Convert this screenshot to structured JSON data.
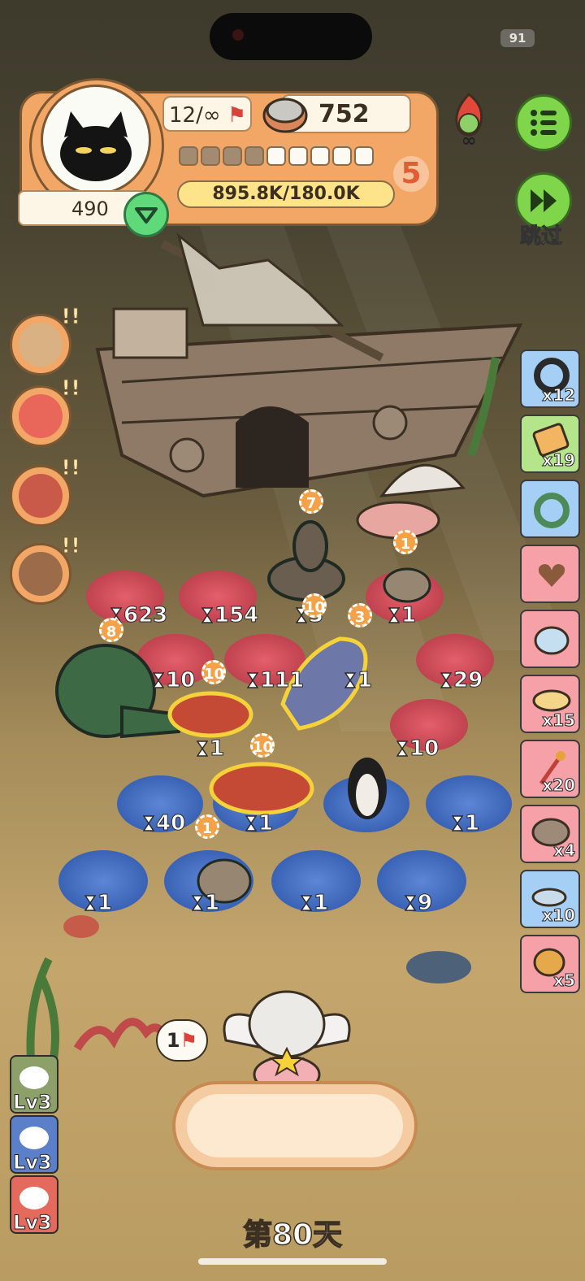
{
  "status_bar": {
    "battery": "91"
  },
  "profile": {
    "level_text": "12/∞",
    "coins": "752",
    "stage": "5",
    "progress_text": "895.8K/180.0K",
    "gems": "490",
    "segments_filled": 4,
    "segments_total": 9
  },
  "skip": {
    "label": "跳过"
  },
  "left_buttons": [
    "box-icon",
    "bear-icon",
    "phone-icon",
    "chest-icon"
  ],
  "items": [
    {
      "icon": "ring-icon",
      "count": "x12",
      "color": "blue"
    },
    {
      "icon": "ticket-icon",
      "count": "x19",
      "color": "green"
    },
    {
      "icon": "loop-icon",
      "count": "",
      "color": "blue"
    },
    {
      "icon": "heart-icon",
      "count": "",
      "color": "pink"
    },
    {
      "icon": "blob-icon",
      "count": "",
      "color": "pink"
    },
    {
      "icon": "goggles-icon",
      "count": "x15",
      "color": "pink"
    },
    {
      "icon": "wand-icon",
      "count": "x20",
      "color": "pink"
    },
    {
      "icon": "stone-icon",
      "count": "x4",
      "color": "pink"
    },
    {
      "icon": "flying-fish-icon",
      "count": "x10",
      "color": "blue"
    },
    {
      "icon": "shell-icon",
      "count": "x5",
      "color": "pink"
    }
  ],
  "pads": {
    "p1": "623",
    "p2": "154",
    "p3": "3",
    "p4": "1",
    "p5": "10",
    "p6": "111",
    "p7": "1",
    "p8": "29",
    "p9": "1",
    "p10": "10",
    "p11": "40",
    "p12": "1",
    "p13": "1",
    "p14": "1",
    "p15": "1",
    "p16": "1",
    "p17": "9"
  },
  "badges": {
    "b1": "7",
    "b2": "1",
    "b3": "8",
    "b4": "10",
    "b5": "3",
    "b6": "10",
    "b7": "10",
    "b8": "1"
  },
  "bubble": {
    "text": "1"
  },
  "levels": [
    "Lv3",
    "Lv3",
    "Lv3"
  ],
  "day": "第80天",
  "colors": {
    "accent": "#f3a766",
    "green": "#7fd64a",
    "pad_red": "#c0434f",
    "pad_blue": "#3b63b5"
  }
}
